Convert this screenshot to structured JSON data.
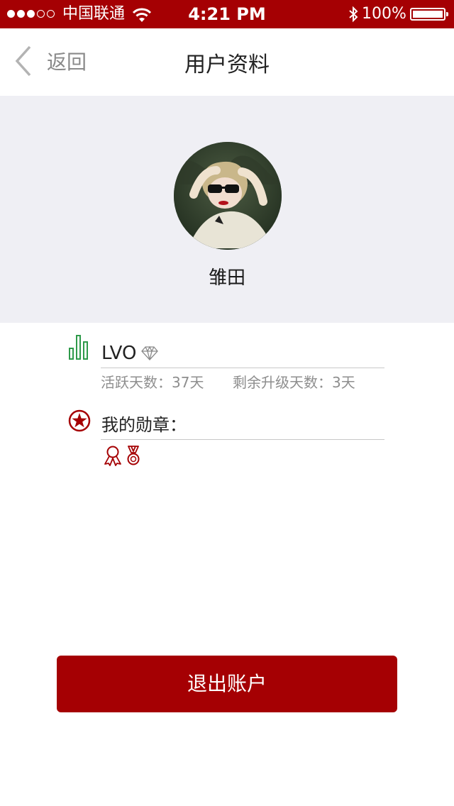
{
  "status_bar": {
    "carrier": "中国联通",
    "time": "4:21 PM",
    "battery": "100%",
    "signal_strength": 3,
    "signal_max": 5
  },
  "nav": {
    "back_label": "返回",
    "title": "用户资料"
  },
  "profile": {
    "username": "雏田"
  },
  "level": {
    "label": "LVO",
    "active_days": "活跃天数：37天",
    "upgrade_days": "剩余升级天数：3天"
  },
  "badges": {
    "label": "我的勋章：",
    "items": [
      "ribbon-badge-icon",
      "medal-icon"
    ]
  },
  "actions": {
    "logout_label": "退出账户"
  },
  "colors": {
    "brand": "#a50003",
    "level_icon": "#2e9a4a",
    "header_bg": "#efeff4"
  }
}
